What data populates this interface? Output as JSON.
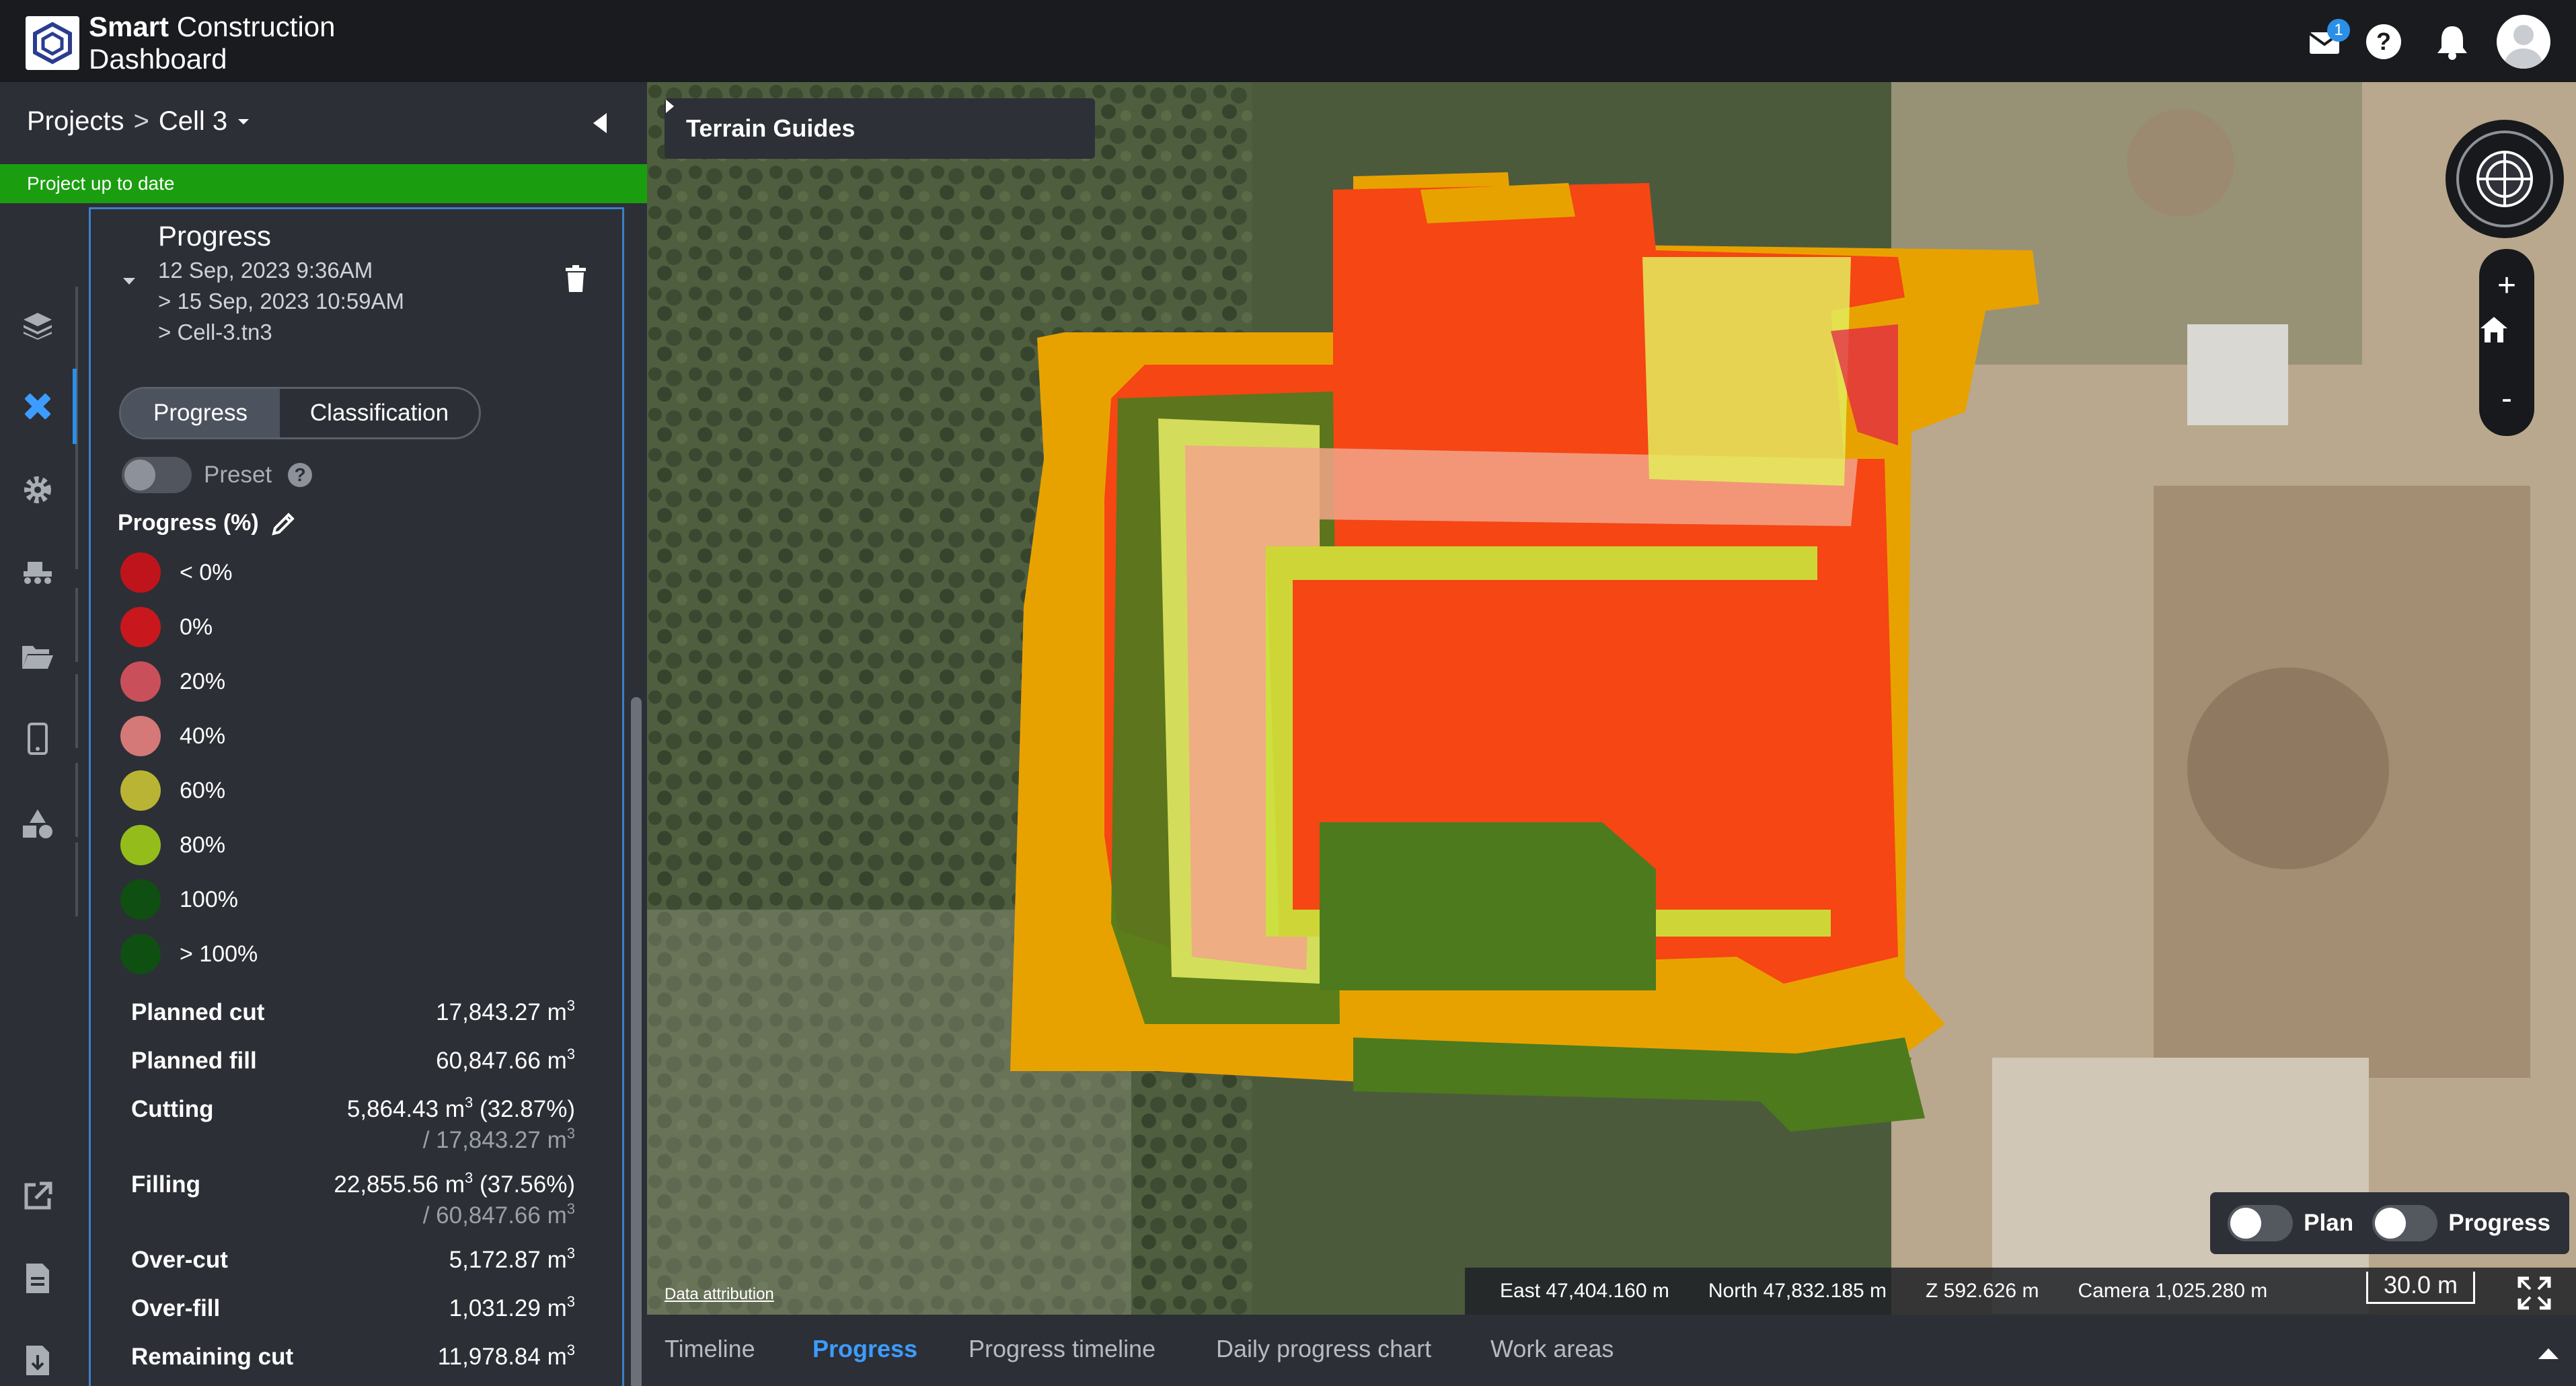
{
  "app": {
    "brand_bold": "Smart",
    "brand_rest": " Construction",
    "brand_line2": "Dashboard",
    "notification_count": "1"
  },
  "breadcrumb": {
    "root": "Projects",
    "separator": ">",
    "current": "Cell 3"
  },
  "status": "Project up to date",
  "panel": {
    "title": "Progress",
    "date_from": "12 Sep, 2023 9:36AM",
    "date_to": "> 15 Sep, 2023 10:59AM",
    "file": "> Cell-3.tn3",
    "tabs": [
      "Progress",
      "Classification"
    ],
    "preset_label": "Preset",
    "progress_header": "Progress (%)",
    "legend": [
      {
        "label": "< 0%",
        "color": "#c0141c"
      },
      {
        "label": "0%",
        "color": "#c8181d"
      },
      {
        "label": "20%",
        "color": "#c9505b"
      },
      {
        "label": "40%",
        "color": "#d47878"
      },
      {
        "label": "60%",
        "color": "#b9b433"
      },
      {
        "label": "80%",
        "color": "#94bd1c"
      },
      {
        "label": "100%",
        "color": "#0f4f12"
      },
      {
        "label": "> 100%",
        "color": "#0f4f12"
      }
    ],
    "stats": [
      {
        "label": "Planned cut",
        "value": "17,843.27 m",
        "sub": ""
      },
      {
        "label": "Planned fill",
        "value": "60,847.66 m",
        "sub": ""
      },
      {
        "label": "Cutting",
        "value": "5,864.43 m",
        "value_suffix": " (32.87%)",
        "sub": "/ 17,843.27 m"
      },
      {
        "label": "Filling",
        "value": "22,855.56 m",
        "value_suffix": " (37.56%)",
        "sub": "/ 60,847.66 m"
      },
      {
        "label": "Over-cut",
        "value": "5,172.87 m",
        "sub": ""
      },
      {
        "label": "Over-fill",
        "value": "1,031.29 m",
        "sub": ""
      },
      {
        "label": "Remaining cut",
        "value": "11,978.84 m",
        "sub": ""
      }
    ],
    "unit_power": "3"
  },
  "map": {
    "terrain_guides": "Terrain Guides",
    "zoom_in": "+",
    "zoom_out": "-",
    "toggle_plan": "Plan",
    "toggle_progress": "Progress",
    "attribution": "Data attribution",
    "east": "East 47,404.160 m",
    "north": "North 47,832.185 m",
    "z": "Z 592.626 m",
    "camera": "Camera 1,025.280 m",
    "scale": "30.0 m"
  },
  "bottom_tabs": [
    "Timeline",
    "Progress",
    "Progress timeline",
    "Daily progress chart",
    "Work areas"
  ],
  "active_tab": "Progress",
  "colors": {
    "accent": "#2b8fe8",
    "status_green": "#1a9e10",
    "panel_bg": "#2c2f36",
    "header_bg": "#191b1f"
  }
}
